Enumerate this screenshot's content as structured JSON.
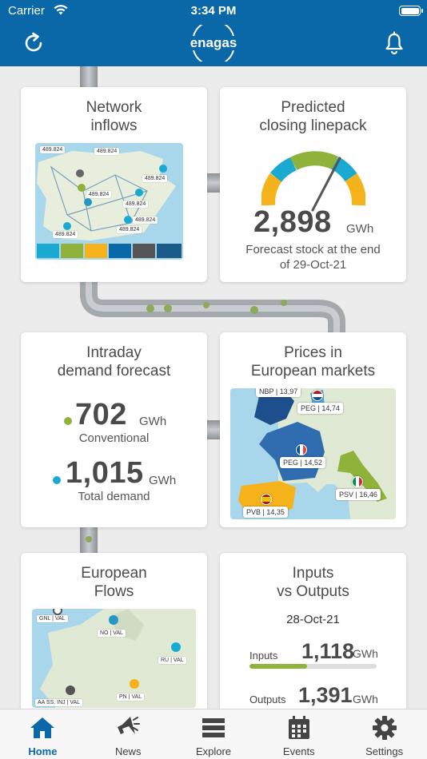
{
  "status": {
    "carrier": "Carrier",
    "time": "3:34 PM"
  },
  "header": {
    "logo": "enagas"
  },
  "cards": {
    "network_inflows": {
      "title_line1": "Network",
      "title_line2": "inflows",
      "labels": [
        "489.824",
        "489.824",
        "489.824",
        "489.824",
        "489.824",
        "489.824",
        "489.824",
        "489.824"
      ]
    },
    "linepack": {
      "title_line1": "Predicted",
      "title_line2": "closing linepack",
      "value": "2,898",
      "unit": "GWh",
      "sub_line1": "Forecast stock at the end",
      "sub_line2": "of 29-Oct-21"
    },
    "intraday": {
      "title_line1": "Intraday",
      "title_line2": "demand forecast",
      "conventional_value": "702",
      "conventional_unit": "GWh",
      "conventional_label": "Conventional",
      "total_value": "1,015",
      "total_unit": "GWh",
      "total_label": "Total demand"
    },
    "prices": {
      "title_line1": "Prices in",
      "title_line2": "European markets",
      "nbp": "NBP | 13,97",
      "peg_nl": "PEG | 14,74",
      "peg_fr": "PEG | 14,52",
      "psv": "PSV | 16,46",
      "pvb": "PVB | 14,35"
    },
    "flows": {
      "title_line1": "European",
      "title_line2": "Flows",
      "gnl": "GNL",
      "gnl_val": "VAL",
      "no": "NO",
      "no_val": "VAL",
      "ru": "RU",
      "ru_val": "VAL",
      "aa": "AA SS. INJ",
      "aa_val": "VAL",
      "pn": "PN",
      "pn_val": "VAL"
    },
    "io": {
      "title_line1": "Inputs",
      "title_line2": "vs Outputs",
      "date": "28-Oct-21",
      "inputs_label": "Inputs",
      "inputs_value": "1,118",
      "inputs_unit": "GWh",
      "inputs_fraction": 0.45,
      "outputs_label": "Outputs",
      "outputs_value": "1,391",
      "outputs_unit": "GWh"
    }
  },
  "tabs": [
    {
      "label": "Home",
      "icon": "home-icon",
      "active": true
    },
    {
      "label": "News",
      "icon": "megaphone-icon"
    },
    {
      "label": "Explore",
      "icon": "list-icon"
    },
    {
      "label": "Events",
      "icon": "calendar-icon"
    },
    {
      "label": "Settings",
      "icon": "gear-icon"
    }
  ],
  "colors": {
    "primary": "#0a67a8",
    "green": "#8fb33a",
    "teal": "#1aa9d1",
    "yellow": "#f5b21b"
  }
}
